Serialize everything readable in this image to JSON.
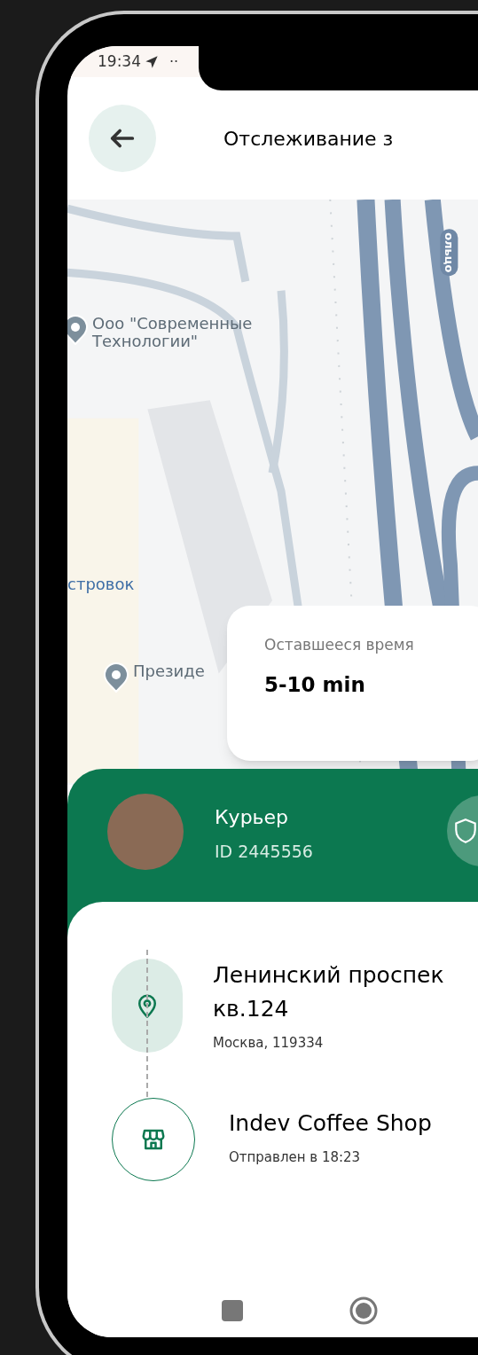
{
  "status_bar": {
    "time": "19:34",
    "overflow": "··"
  },
  "header": {
    "title": "Отслеживание з"
  },
  "map": {
    "labels": [
      {
        "kind": "poi",
        "text": "Ооо \"Современные Технологии\""
      },
      {
        "kind": "district",
        "text": "стровок"
      },
      {
        "kind": "poi",
        "text": "Президе"
      },
      {
        "kind": "road",
        "text": "ольцо"
      }
    ]
  },
  "eta": {
    "label": "Оставшееся время",
    "value": "5-10 min"
  },
  "courier": {
    "role": "Курьер",
    "id": "ID 2445556"
  },
  "stops": [
    {
      "kind": "destination",
      "lines": [
        "Ленинский проспек",
        "кв.124"
      ],
      "subtitle": "Москва, 119334"
    },
    {
      "kind": "shop",
      "lines": [
        "Indev Coffee Shop"
      ],
      "subtitle": "Отправлен в 18:23"
    }
  ]
}
